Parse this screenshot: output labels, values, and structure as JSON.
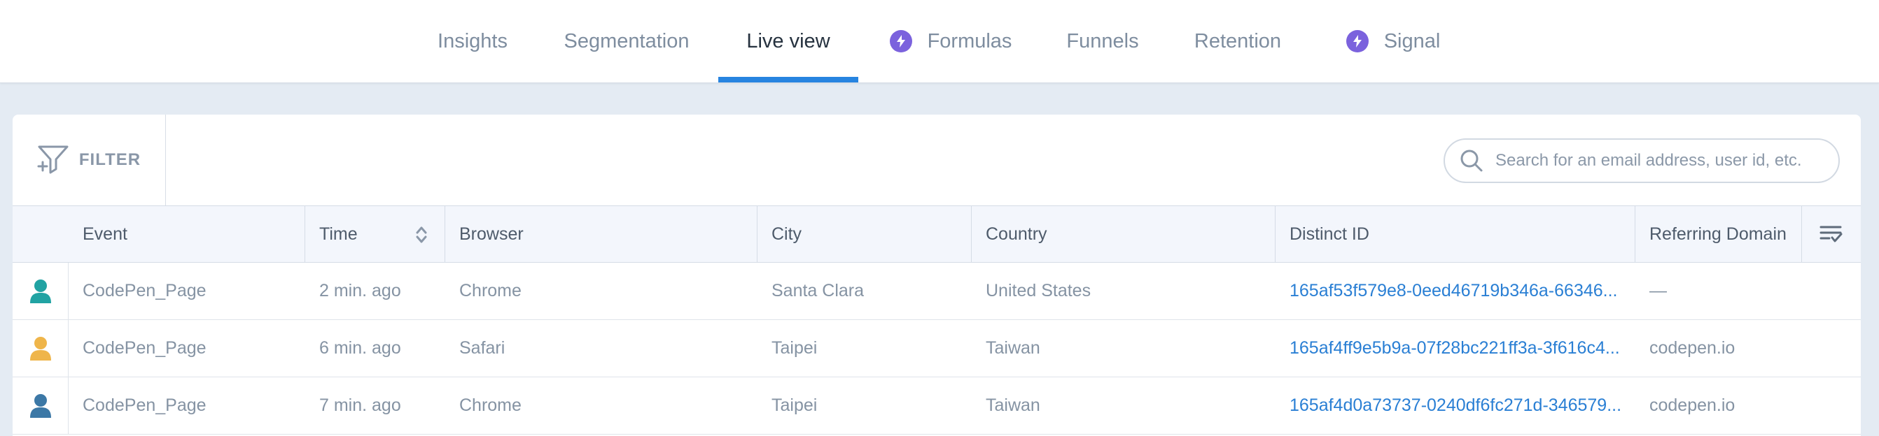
{
  "nav": {
    "tabs": [
      {
        "label": "Insights",
        "active": false,
        "bolt": false
      },
      {
        "label": "Segmentation",
        "active": false,
        "bolt": false
      },
      {
        "label": "Live view",
        "active": true,
        "bolt": false
      },
      {
        "label": "Formulas",
        "active": false,
        "bolt": true
      },
      {
        "label": "Funnels",
        "active": false,
        "bolt": false
      },
      {
        "label": "Retention",
        "active": false,
        "bolt": false
      },
      {
        "label": "Signal",
        "active": false,
        "bolt": true
      }
    ],
    "accent_color": "#2784e0",
    "bolt_color": "#7b62dd"
  },
  "toolbar": {
    "filter_label": "FILTER",
    "filter_icon": "funnel-plus-icon",
    "search_placeholder": "Search for an email address, user id, etc.",
    "search_value": "",
    "search_icon": "search-icon"
  },
  "table": {
    "columns": [
      "Event",
      "Time",
      "Browser",
      "City",
      "Country",
      "Distinct ID",
      "Referring Domain"
    ],
    "sort_icon": "sort-toggle-icon",
    "column_menu_icon": "column-settings-icon",
    "rows": [
      {
        "avatar_color": "#21a3a3",
        "event": "CodePen_Page",
        "time": "2 min. ago",
        "browser": "Chrome",
        "city": "Santa Clara",
        "country": "United States",
        "distinct_id": "165af53f579e8-0eed46719b346a-66346...",
        "referring_domain": "—"
      },
      {
        "avatar_color": "#efb54a",
        "event": "CodePen_Page",
        "time": "6 min. ago",
        "browser": "Safari",
        "city": "Taipei",
        "country": "Taiwan",
        "distinct_id": "165af4ff9e5b9a-07f28bc221ff3a-3f616c4...",
        "referring_domain": "codepen.io"
      },
      {
        "avatar_color": "#3c78a6",
        "event": "CodePen_Page",
        "time": "7 min. ago",
        "browser": "Chrome",
        "city": "Taipei",
        "country": "Taiwan",
        "distinct_id": "165af4d0a73737-0240df6fc271d-346579...",
        "referring_domain": "codepen.io"
      }
    ]
  }
}
